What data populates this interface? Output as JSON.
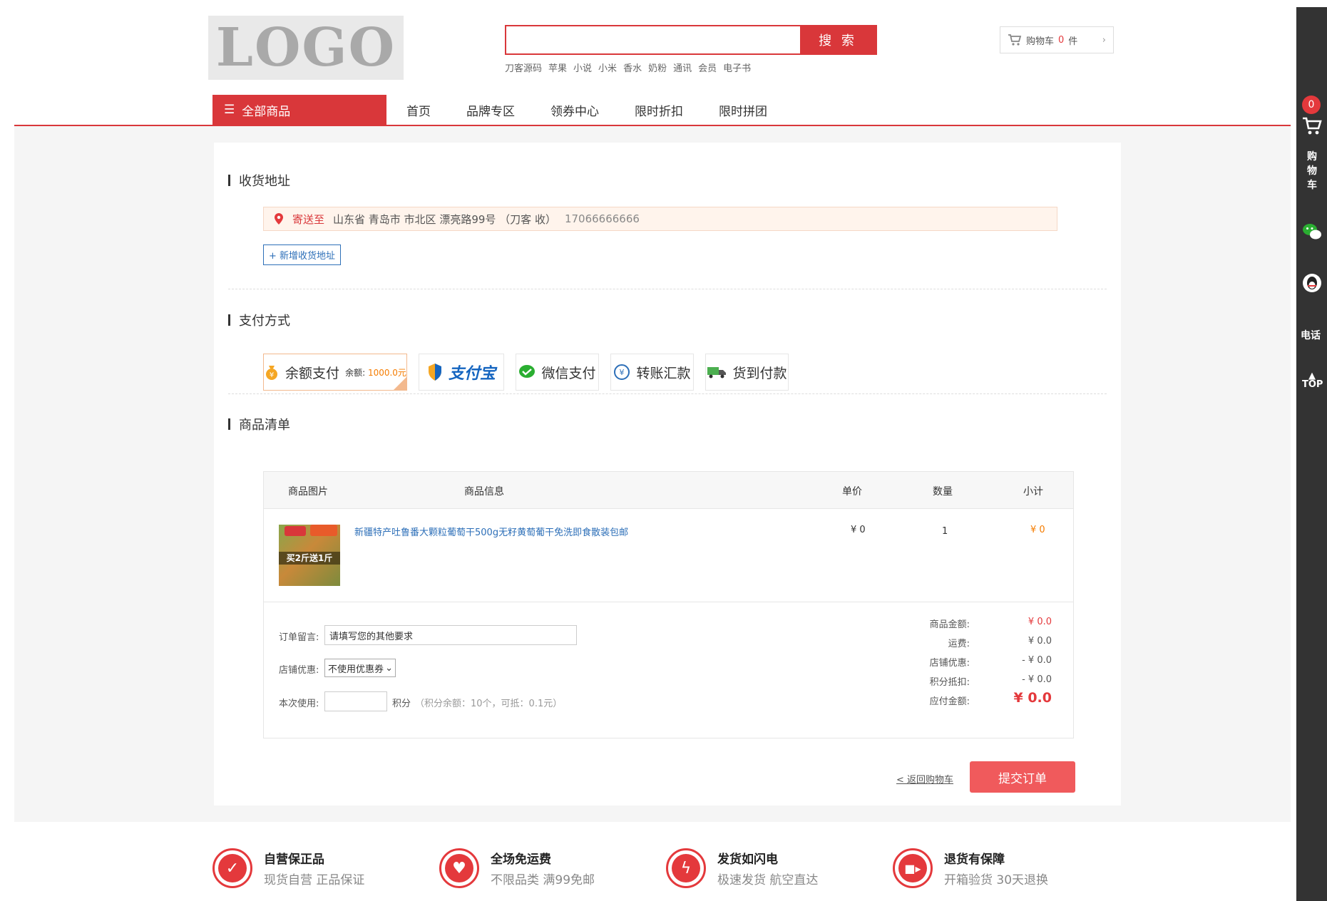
{
  "header": {
    "logo": "LOGO",
    "search_placeholder": "",
    "search_button": "搜 索",
    "hot_words": [
      "刀客源码",
      "苹果",
      "小说",
      "小米",
      "香水",
      "奶粉",
      "通讯",
      "会员",
      "电子书"
    ],
    "cart_label": "购物车",
    "cart_count": "0",
    "cart_unit": "件"
  },
  "nav": {
    "all_label": "全部商品",
    "items": [
      "首页",
      "品牌专区",
      "领券中心",
      "限时折扣",
      "限时拼团"
    ]
  },
  "address": {
    "title": "收货地址",
    "ship_to": "寄送至",
    "text": "山东省 青岛市 市北区 漂亮路99号 （刀客 收）",
    "phone": "17066666666",
    "new_button": "+ 新增收货地址"
  },
  "payment": {
    "title": "支付方式",
    "balance_label": "余额支付",
    "balance_prefix": "余额:",
    "balance_value": "1000.0元",
    "alipay_label": "支付宝",
    "wechat_label": "微信支付",
    "transfer_label": "转账汇款",
    "cod_label": "货到付款"
  },
  "goods": {
    "title": "商品清单",
    "headers": [
      "商品图片",
      "商品信息",
      "单价",
      "数量",
      "小计"
    ],
    "items": [
      {
        "image_tag": "买2斤送1斤",
        "name": "新疆特产吐鲁番大颗粒葡萄干500g无籽黄萄葡干免洗即食散装包邮",
        "price": "¥ 0",
        "qty": "1",
        "subtotal": "¥ 0"
      }
    ],
    "note_label": "订单留言:",
    "note_placeholder": "请填写您的其他要求",
    "coupon_label": "店铺优惠:",
    "coupon_selected": "不使用优惠券",
    "points_label": "本次使用:",
    "points_unit": "积分",
    "points_hint": "（积分余额：10个，可抵：0.1元）",
    "summary": [
      {
        "label": "商品金额:",
        "value": "¥ 0.0"
      },
      {
        "label": "运费:",
        "value": "¥ 0.0"
      },
      {
        "label": "店铺优惠:",
        "value": "- ¥ 0.0"
      },
      {
        "label": "积分抵扣:",
        "value": "- ¥ 0.0"
      },
      {
        "label": "应付金额:",
        "value": "¥ 0.0"
      }
    ],
    "back_link": "< 返回购物车",
    "submit": "提交订单"
  },
  "features": [
    {
      "icon": "shield-icon",
      "title": "自营保正品",
      "desc": "现货自营 正品保证"
    },
    {
      "icon": "heart-hand-icon",
      "title": "全场免运费",
      "desc": "不限品类 满99免邮"
    },
    {
      "icon": "lightning-icon",
      "title": "发货如闪电",
      "desc": "极速发货 航空直达"
    },
    {
      "icon": "truck-icon",
      "title": "退货有保障",
      "desc": "开箱验货 30天退换"
    }
  ],
  "sidebar": {
    "cart_badge": "0",
    "cart_text": "购物车",
    "tel_text": "电话",
    "top_text": "TOP"
  },
  "colors": {
    "accent": "#d9373a",
    "link": "#2d6fb8",
    "price": "#f57c00",
    "submit": "#f05a5c"
  }
}
